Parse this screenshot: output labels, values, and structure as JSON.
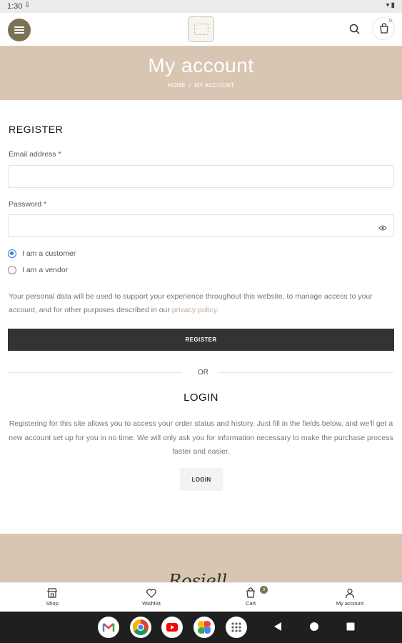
{
  "status_bar": {
    "time": "1:30",
    "extra_icon": "sdl-icon"
  },
  "header": {
    "menu_icon": "hamburger-menu-icon",
    "logo": "shop-logo",
    "search_icon": "search-icon",
    "cart_icon": "shopping-bag-icon",
    "cart_count": "0"
  },
  "hero": {
    "title": "My account",
    "breadcrumb": {
      "home": "HOME",
      "separator": "/",
      "current": "MY ACCOUNT"
    },
    "background_color": "#d9c6b2"
  },
  "register": {
    "title": "REGISTER",
    "email_label": "Email address",
    "email_value": "",
    "password_label": "Password",
    "password_value": "",
    "required_mark": "*",
    "role_options": [
      {
        "label": "I am a customer",
        "selected": true
      },
      {
        "label": "I am a vendor",
        "selected": false
      }
    ],
    "privacy_text": "Your personal data will be used to support your experience throughout this website, to manage access to your account, and for other purposes described in our ",
    "privacy_link": "privacy policy",
    "privacy_end": ".",
    "button_label": "REGISTER"
  },
  "divider_text": "OR",
  "login": {
    "title": "LOGIN",
    "description": "Registering for this site allows you to access your order status and history. Just fill in the fields below, and we'll get a new account set up for you in no time. We will only ask you for information necessary to make the purchase process faster and easier.",
    "button_label": "LOGIN"
  },
  "footer": {
    "script_text": "Rosiell"
  },
  "bottom_nav": [
    {
      "label": "Shop",
      "icon": "shop-icon"
    },
    {
      "label": "Wishlist",
      "icon": "heart-icon"
    },
    {
      "label": "Cart",
      "icon": "cart-icon",
      "badge": "0"
    },
    {
      "label": "My account",
      "icon": "user-icon"
    }
  ],
  "android_nav": {
    "apps": [
      "gmail-icon",
      "chrome-icon",
      "youtube-icon",
      "photos-icon",
      "app-drawer-icon"
    ],
    "buttons": [
      "back-icon",
      "home-icon",
      "recents-icon"
    ]
  },
  "colors": {
    "accent": "#7a7255",
    "button_dark": "#333333",
    "link": "#c4ad92",
    "required": "#c83636"
  }
}
